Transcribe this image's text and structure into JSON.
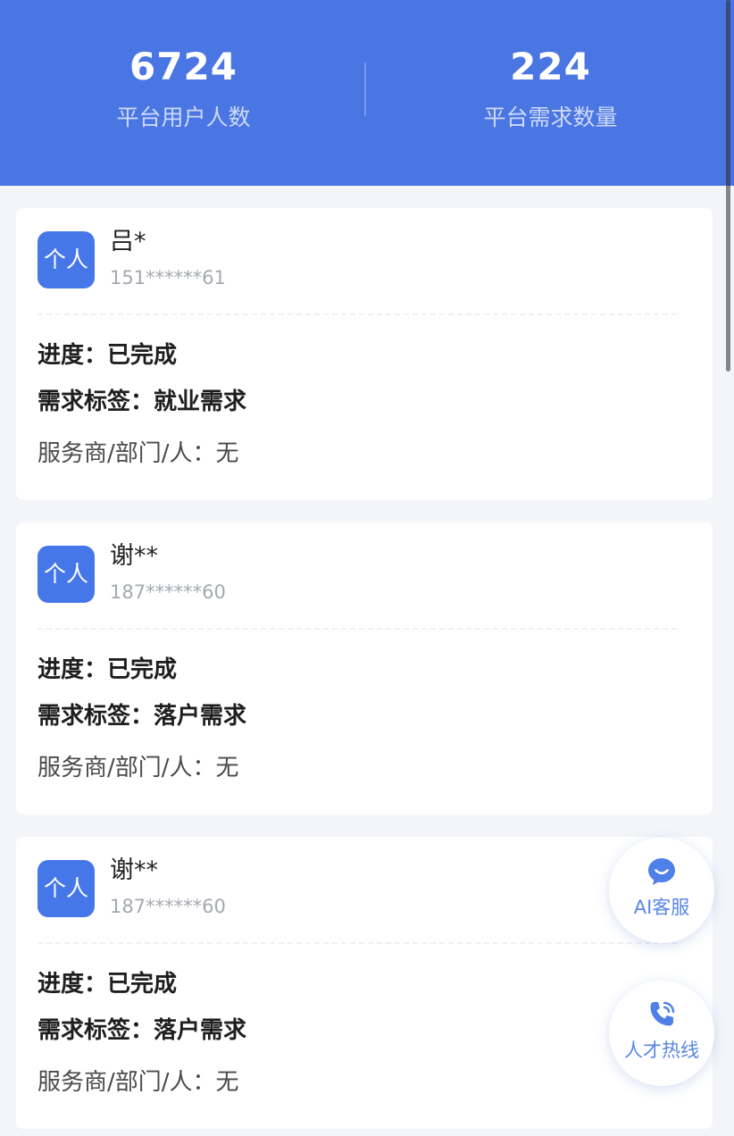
{
  "header": {
    "stats": [
      {
        "value": "6724",
        "label": "平台用户人数"
      },
      {
        "value": "224",
        "label": "平台需求数量"
      }
    ]
  },
  "records": [
    {
      "badge": "个人",
      "name": "吕*",
      "phone": "151******61",
      "progress": "进度：已完成",
      "tag": "需求标签：就业需求",
      "provider": "服务商/部门/人：无"
    },
    {
      "badge": "个人",
      "name": "谢**",
      "phone": "187******60",
      "progress": "进度：已完成",
      "tag": "需求标签：落户需求",
      "provider": "服务商/部门/人：无"
    },
    {
      "badge": "个人",
      "name": "谢**",
      "phone": "187******60",
      "progress": "进度：已完成",
      "tag": "需求标签：落户需求",
      "provider": "服务商/部门/人：无"
    }
  ],
  "floating": {
    "ai_service": {
      "label": "AI客服",
      "icon": "chat-bubble-icon"
    },
    "hotline": {
      "label": "人才热线",
      "icon": "phone-icon"
    }
  },
  "colors": {
    "primary": "#4a76e3",
    "badge": "#4677e8",
    "float_label": "#5a86e6"
  }
}
